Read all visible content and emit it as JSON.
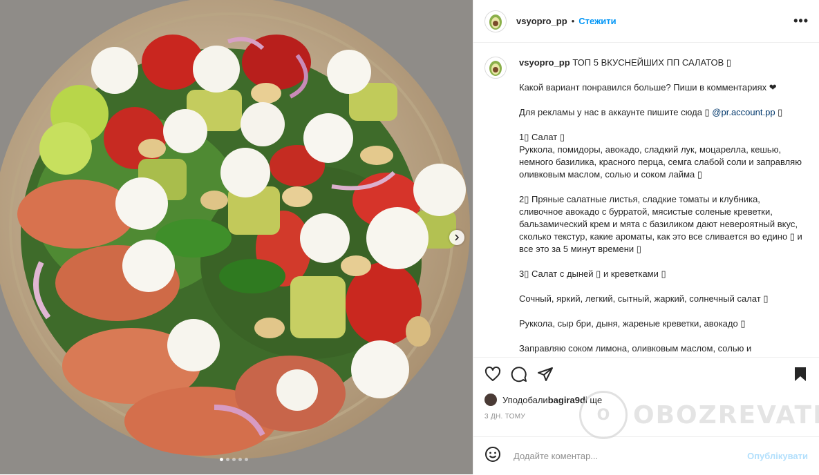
{
  "post": {
    "username": "vsyopro_pp",
    "separator": "•",
    "follow_label": "Стежити",
    "more_label": "•••"
  },
  "caption": {
    "username": "vsyopro_pp",
    "title": "ТОП 5 ВКУСНЕЙШИХ ПП САЛАТОВ ▯",
    "p1": "Какой вариант понравился больше? Пиши в комментариях ❤",
    "p2_text": "Для рекламы у нас в аккаунте пишите сюда ▯ ",
    "p2_link": "@pr.account.pp",
    "p2_end": " ▯",
    "p3": "1▯ Салат ▯\nРуккола, помидоры, авокадо, сладкий лук, моцарелла, кешью, немного базилика, красного перца, семга слабой соли и заправляю оливковым маслом, солью и соком лайма ▯",
    "p4": "2▯ Пряные салатные листья, сладкие томаты и клубника, сливочное авокадо с бурратой, мясистые соленые креветки, бальзамический крем и мята с базиликом дают невероятный вкус, сколько текстур, какие ароматы, как это все сливается во едино ▯ и все это за 5 минут времени ▯",
    "p5": "3▯ Салат с дыней ▯ и креветками ▯",
    "p6": "Сочный, яркий, легкий, сытный, жаркий, солнечный салат ▯",
    "p7": "Руккола, сыр бри, дыня, жареные креветки, авокадо ▯",
    "p8": "Заправляю соком лимона, оливковым маслом, солью и"
  },
  "likes": {
    "prefix": "Уподобали ",
    "user": "bagira9d",
    "suffix": " і ще"
  },
  "time": "3 ДН. ТОМУ",
  "comment": {
    "placeholder": "Додайте коментар...",
    "publish_label": "Опублікувати"
  },
  "watermark": {
    "logo_text": "О",
    "brand": "OBOZREVATEL"
  },
  "carousel": {
    "slide_count": 5,
    "active_index": 0
  },
  "colors": {
    "accent": "#0095f6",
    "publish_disabled": "#b2dffc",
    "text": "#262626",
    "muted": "#8e8e8e"
  },
  "icons": [
    "heart-icon",
    "comment-icon",
    "share-icon",
    "bookmark-icon",
    "emoji-icon",
    "chevron-right-icon",
    "more-icon"
  ]
}
